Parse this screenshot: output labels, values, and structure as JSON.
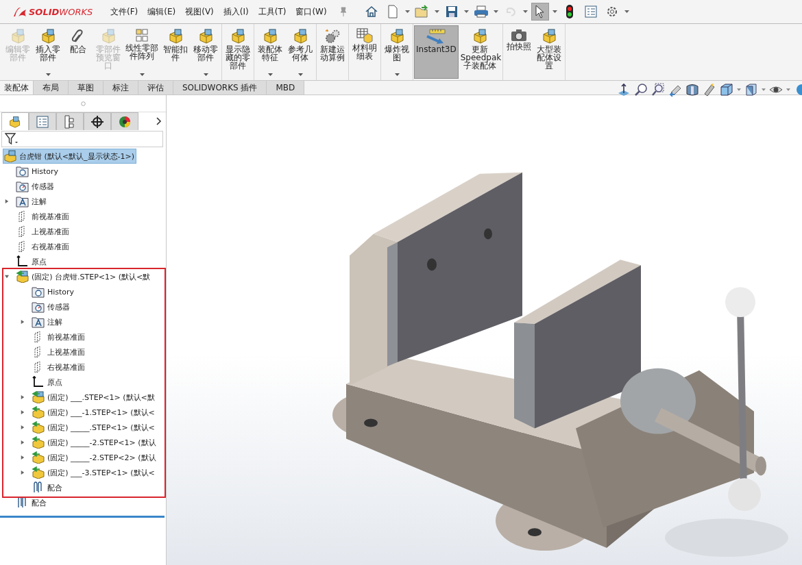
{
  "app": {
    "logo": "**SOLID**WORKS"
  },
  "menu": [
    "文件(F)",
    "编辑(E)",
    "视图(V)",
    "插入(I)",
    "工具(T)",
    "窗口(W)"
  ],
  "quick_access": [
    {
      "dropdown": false,
      "disabled": false,
      "pressed": false
    },
    {
      "dropdown": true,
      "disabled": false,
      "pressed": false
    },
    {
      "dropdown": true,
      "disabled": false,
      "pressed": false
    },
    {
      "dropdown": true,
      "disabled": false,
      "pressed": false
    },
    {
      "dropdown": true,
      "disabled": false,
      "pressed": false
    },
    {
      "dropdown": true,
      "disabled": true,
      "pressed": false
    },
    {
      "dropdown": true,
      "disabled": false,
      "pressed": true
    },
    {
      "dropdown": false,
      "disabled": false,
      "pressed": false
    },
    {
      "dropdown": false,
      "disabled": false,
      "pressed": false
    },
    {
      "dropdown": true,
      "disabled": false,
      "pressed": false
    }
  ],
  "ribbon": [
    {
      "items": [
        {
          "label": "编辑零部件",
          "disabled": true,
          "dropdown": false,
          "selected": false
        },
        {
          "label": "插入零部件",
          "disabled": false,
          "dropdown": true,
          "selected": false
        },
        {
          "label": "配合",
          "disabled": false,
          "dropdown": false,
          "selected": false
        },
        {
          "label": "零部件预览窗口",
          "disabled": true,
          "dropdown": false,
          "selected": false
        },
        {
          "label": "线性零部件阵列",
          "disabled": false,
          "dropdown": true,
          "selected": false
        },
        {
          "label": "智能扣件",
          "disabled": false,
          "dropdown": false,
          "selected": false
        },
        {
          "label": "移动零部件",
          "disabled": false,
          "dropdown": true,
          "selected": false
        }
      ]
    },
    {
      "items": [
        {
          "label": "显示隐藏的零部件",
          "disabled": false,
          "dropdown": false,
          "selected": false
        }
      ]
    },
    {
      "items": [
        {
          "label": "装配体特征",
          "disabled": false,
          "dropdown": true,
          "selected": false
        },
        {
          "label": "参考几何体",
          "disabled": false,
          "dropdown": true,
          "selected": false
        }
      ]
    },
    {
      "items": [
        {
          "label": "新建运动算例",
          "disabled": false,
          "dropdown": false,
          "selected": false
        }
      ]
    },
    {
      "items": [
        {
          "label": "材料明细表",
          "disabled": false,
          "dropdown": false,
          "selected": false
        }
      ]
    },
    {
      "items": [
        {
          "label": "爆炸视图",
          "disabled": false,
          "dropdown": true,
          "selected": false
        }
      ]
    },
    {
      "items": [
        {
          "label": "Instant3D",
          "disabled": false,
          "dropdown": false,
          "selected": true
        },
        {
          "label": "更新Speedpak子装配体",
          "disabled": false,
          "dropdown": false,
          "selected": false
        }
      ]
    },
    {
      "items": [
        {
          "label": "拍快照",
          "disabled": false,
          "dropdown": false,
          "selected": false
        },
        {
          "label": "大型装配体设置",
          "disabled": false,
          "dropdown": false,
          "selected": false
        }
      ]
    }
  ],
  "command_tabs": [
    {
      "label": "装配体",
      "selected": true
    },
    {
      "label": "布局",
      "selected": false
    },
    {
      "label": "草图",
      "selected": false
    },
    {
      "label": "标注",
      "selected": false
    },
    {
      "label": "评估",
      "selected": false
    },
    {
      "label": "SOLIDWORKS 插件",
      "selected": false
    },
    {
      "label": "MBD",
      "selected": false
    }
  ],
  "feature_manager": {
    "tabs": [
      {
        "selected": true
      },
      {
        "selected": false
      },
      {
        "selected": false
      },
      {
        "selected": false
      },
      {
        "selected": false
      }
    ],
    "tree": {
      "label": "台虎钳  (默认<默认_显示状态-1>)",
      "kind": "assembly",
      "selected": true,
      "children": [
        {
          "label": "History",
          "kind": "history",
          "selected": false
        },
        {
          "label": "传感器",
          "kind": "sensors",
          "selected": false
        },
        {
          "label": "注解",
          "kind": "annotations",
          "selected": false,
          "expanded": false
        },
        {
          "label": "前视基准面",
          "kind": "plane",
          "selected": false
        },
        {
          "label": "上视基准面",
          "kind": "plane",
          "selected": false
        },
        {
          "label": "右视基准面",
          "kind": "plane",
          "selected": false
        },
        {
          "label": "原点",
          "kind": "origin",
          "selected": false
        },
        {
          "label": "(固定) 台虎钳.STEP<1> (默认<默",
          "kind": "subassembly",
          "selected": false,
          "expanded": true,
          "highlighted": true,
          "children": [
            {
              "label": "History",
              "kind": "history",
              "selected": false
            },
            {
              "label": "传感器",
              "kind": "sensors",
              "selected": false
            },
            {
              "label": "注解",
              "kind": "annotations",
              "selected": false,
              "expanded": false
            },
            {
              "label": "前视基准面",
              "kind": "plane",
              "selected": false
            },
            {
              "label": "上视基准面",
              "kind": "plane",
              "selected": false
            },
            {
              "label": "右视基准面",
              "kind": "plane",
              "selected": false
            },
            {
              "label": "原点",
              "kind": "origin",
              "selected": false
            },
            {
              "label": "(固定) ___.STEP<1> (默认<默",
              "kind": "subassembly",
              "selected": false,
              "expanded": false
            },
            {
              "label": "(固定) ___-1.STEP<1> (默认<",
              "kind": "part",
              "selected": false,
              "expanded": false
            },
            {
              "label": "(固定) _____.STEP<1> (默认<",
              "kind": "part",
              "selected": false,
              "expanded": false
            },
            {
              "label": "(固定) _____-2.STEP<1> (默认",
              "kind": "part",
              "selected": false,
              "expanded": false
            },
            {
              "label": "(固定) _____-2.STEP<2> (默认",
              "kind": "part",
              "selected": false,
              "expanded": false
            },
            {
              "label": "(固定) ___-3.STEP<1> (默认<",
              "kind": "part",
              "selected": false,
              "expanded": false
            },
            {
              "label": "配合",
              "kind": "mates",
              "selected": false
            }
          ]
        },
        {
          "label": "配合",
          "kind": "mates",
          "selected": false
        }
      ]
    }
  }
}
